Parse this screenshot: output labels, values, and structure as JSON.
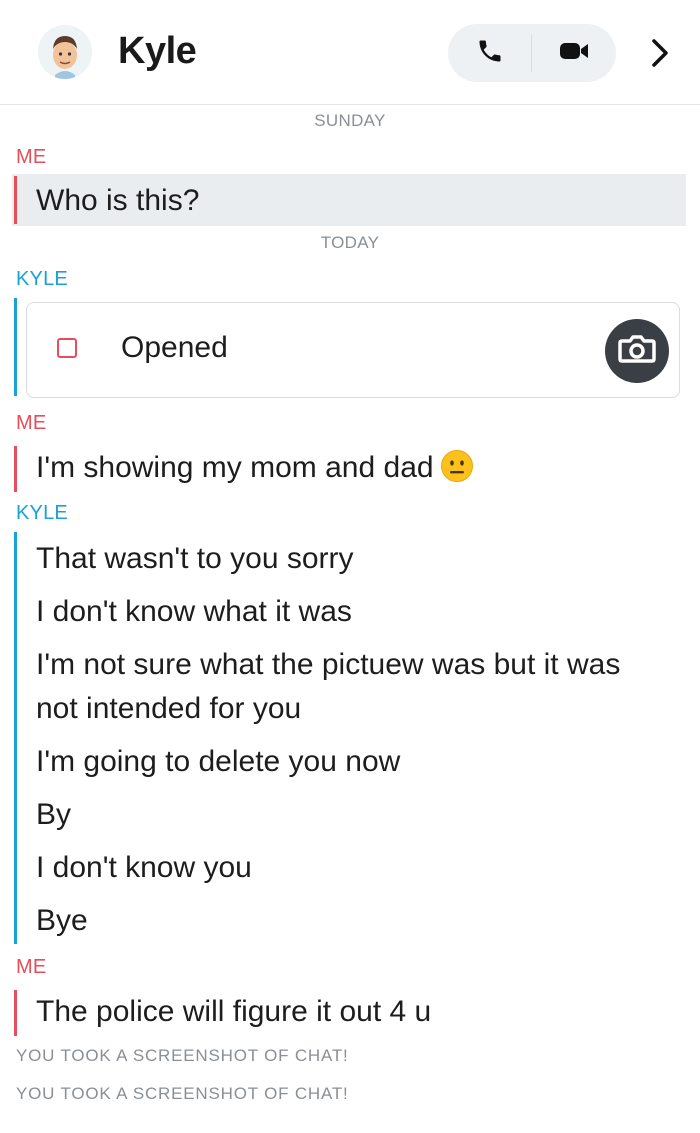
{
  "header": {
    "title": "Kyle",
    "avatar_icon": "bitmoji-avatar-icon",
    "phone_icon": "phone-icon",
    "video_icon": "video-camera-icon",
    "more_icon": "chevron-right-icon"
  },
  "days": {
    "first": "SUNDAY",
    "second": "TODAY"
  },
  "senders": {
    "me": "ME",
    "kyle": "KYLE"
  },
  "messages": {
    "me1": "Who is this?",
    "snap_status": "Opened",
    "me2": "I'm showing my mom and dad",
    "kyle": [
      "That wasn't to you sorry",
      "I don't know what it was",
      "I'm not sure what the pictuew was but it was",
      "not intended for you",
      "I'm going to delete you now",
      "By",
      "I don't know you",
      "Bye"
    ],
    "me3": "The police will figure it out 4 u"
  },
  "system": [
    "YOU TOOK A SCREENSHOT OF CHAT!",
    "YOU TOOK A SCREENSHOT OF CHAT!"
  ],
  "colors": {
    "me": "#e54e5b",
    "kyle": "#1aa1d6"
  }
}
